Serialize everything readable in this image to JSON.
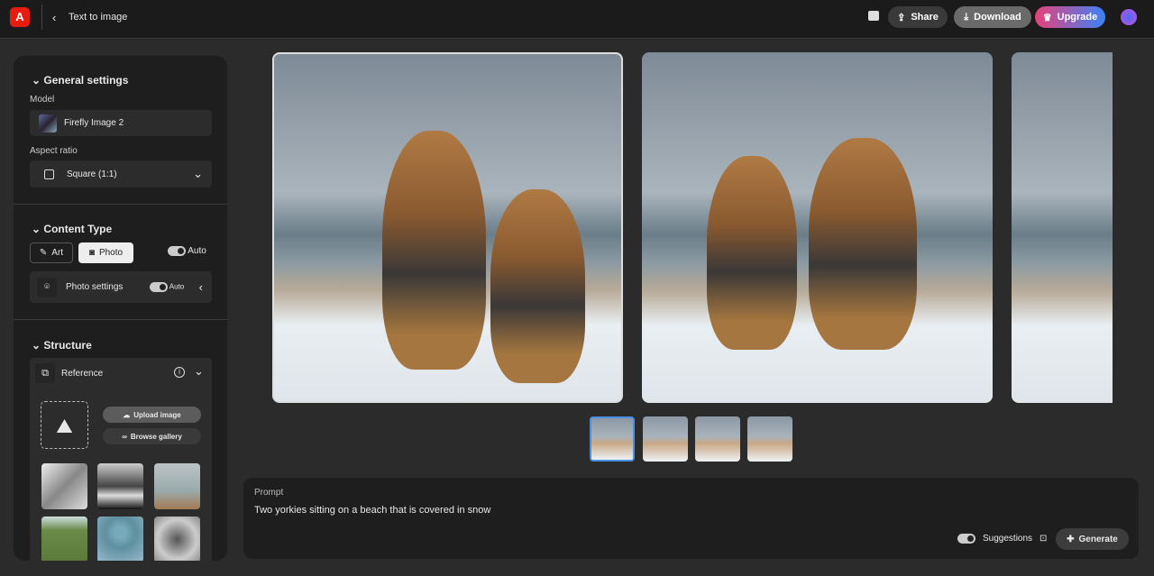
{
  "header": {
    "title": "Text to image",
    "share": "Share",
    "download": "Download",
    "upgrade": "Upgrade"
  },
  "colors": {
    "brand": "#e81c0e",
    "upgrade_start": "#e8417a",
    "upgrade_end": "#3b82f6"
  },
  "general": {
    "title": "General settings",
    "model_label": "Model",
    "model": "Firefly Image 2",
    "aspect_label": "Aspect ratio",
    "aspect": "Square (1:1)"
  },
  "content": {
    "title": "Content Type",
    "art": "Art",
    "photo": "Photo",
    "auto": "Auto",
    "photo_settings": "Photo settings",
    "photo_auto": "Auto"
  },
  "structure": {
    "title": "Structure",
    "reference": "Reference",
    "upload": "Upload image",
    "browse": "Browse gallery"
  },
  "prompt": {
    "label": "Prompt",
    "text": "Two yorkies sitting on a beach that is covered in snow",
    "suggestions": "Suggestions",
    "generate": "Generate"
  },
  "thumbnails": {
    "selected": 1,
    "count": 4
  }
}
